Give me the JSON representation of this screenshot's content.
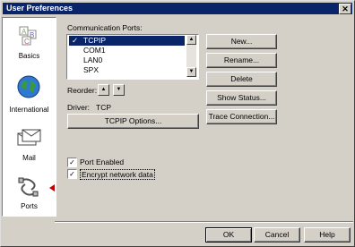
{
  "window": {
    "title": "User Preferences",
    "close_glyph": "✕"
  },
  "sidebar": {
    "items": [
      {
        "label": "Basics",
        "icon": "abc-blocks-icon"
      },
      {
        "label": "International",
        "icon": "globe-icon"
      },
      {
        "label": "Mail",
        "icon": "mail-envelope-icon"
      },
      {
        "label": "Ports",
        "icon": "ports-icon",
        "selected": true
      }
    ]
  },
  "ports": {
    "label": "Communication Ports:",
    "items": [
      {
        "name": "TCPIP",
        "checked": true,
        "selected": true
      },
      {
        "name": "COM1",
        "checked": false
      },
      {
        "name": "LAN0",
        "checked": false
      },
      {
        "name": "SPX",
        "checked": false
      }
    ],
    "check_glyph": "✓",
    "reorder_label": "Reorder:",
    "reorder_up": "▲",
    "reorder_down": "▼",
    "driver_label": "Driver:",
    "driver_value": "TCP",
    "options_button": "TCPIP Options...",
    "port_enabled_label": "Port Enabled",
    "port_enabled": true,
    "encrypt_label": "Encrypt network data",
    "encrypt": true
  },
  "buttons": {
    "new": "New...",
    "rename": "Rename...",
    "delete": "Delete",
    "show_status": "Show Status...",
    "trace": "Trace Connection..."
  },
  "footer": {
    "ok": "OK",
    "cancel": "Cancel",
    "help": "Help"
  },
  "colors": {
    "titlebar": "#0a246a",
    "selection": "#0a246a",
    "arrow": "#c00000",
    "face": "#d4d0c8"
  }
}
